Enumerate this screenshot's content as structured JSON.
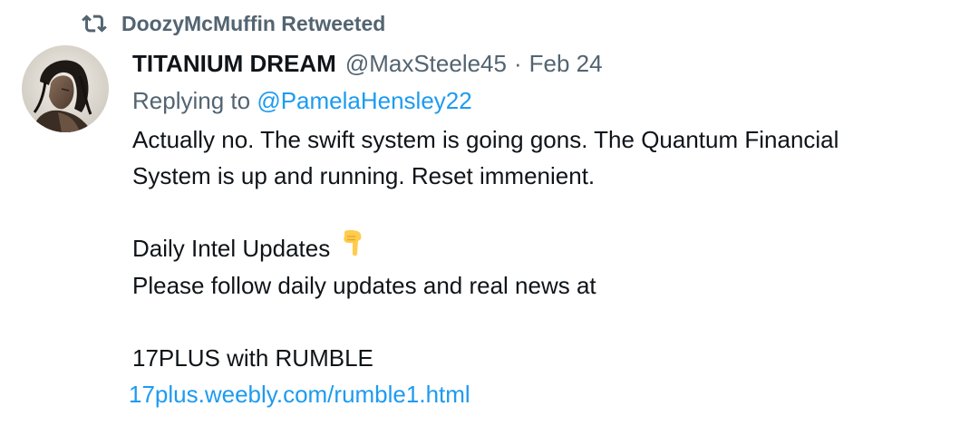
{
  "retweet": {
    "icon": "retweet-icon",
    "text": "DoozyMcMuffin Retweeted"
  },
  "author": {
    "avatar_icon": "avatar",
    "display_name": "TITANIUM DREAM",
    "handle": "@MaxSteele45",
    "separator": "·",
    "date": "Feb 24"
  },
  "reply": {
    "prefix": "Replying to ",
    "handle": "@PamelaHensley22"
  },
  "body": {
    "line1": "Actually no. The swift system is going gons. The Quantum Financial",
    "line2": "System is up and running. Reset immenient.",
    "line3": "Daily Intel Updates",
    "line3_emoji": "pointing-down-icon",
    "line4": "Please follow daily updates and real news at",
    "line5": "17PLUS with RUMBLE",
    "link": "17plus.weebly.com/rumble1.html"
  },
  "colors": {
    "text": "#0f1419",
    "secondary": "#536471",
    "link": "#1d9bf0"
  }
}
